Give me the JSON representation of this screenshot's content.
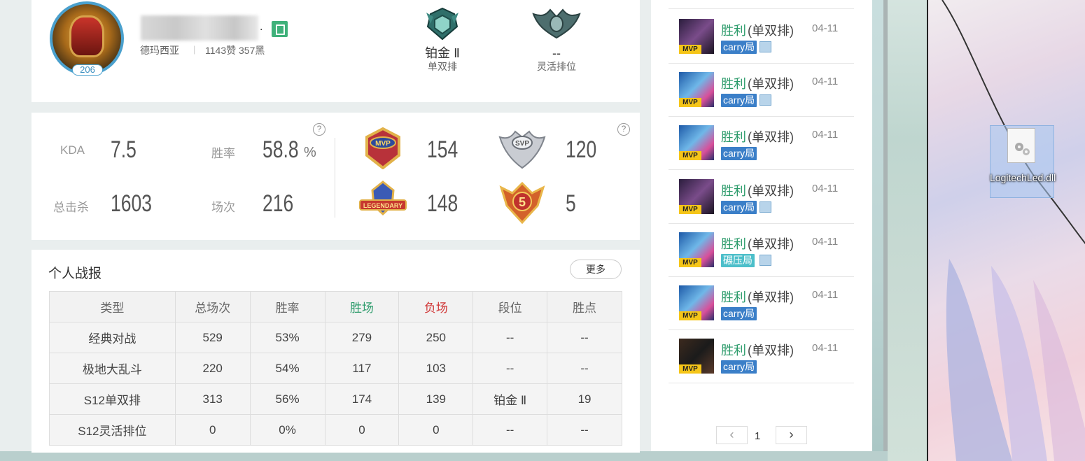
{
  "profile": {
    "name_suffix": ".",
    "level": "206",
    "server": "德玛西亚",
    "likes": "1143赞",
    "blacks": "357黑"
  },
  "ranks": [
    {
      "name": "铂金 Ⅱ",
      "mode": "单双排"
    },
    {
      "name": "--",
      "mode": "灵活排位"
    }
  ],
  "stats": {
    "kda_label": "KDA",
    "kda": "7.5",
    "winrate_label": "胜率",
    "winrate": "58.8",
    "winrate_unit": "%",
    "kills_label": "总击杀",
    "kills": "1603",
    "games_label": "场次",
    "games": "216",
    "help": "?"
  },
  "badges": [
    {
      "icon": "mvp-badge-icon",
      "value": "154"
    },
    {
      "icon": "svp-badge-icon",
      "value": "120"
    },
    {
      "icon": "legendary-badge-icon",
      "value": "148"
    },
    {
      "icon": "pentakill-badge-icon",
      "value": "5"
    }
  ],
  "report": {
    "title": "个人战报",
    "more": "更多",
    "headers": [
      "类型",
      "总场次",
      "胜率",
      "胜场",
      "负场",
      "段位",
      "胜点"
    ],
    "rows": [
      [
        "经典对战",
        "529",
        "53%",
        "279",
        "250",
        "--",
        "--"
      ],
      [
        "极地大乱斗",
        "220",
        "54%",
        "117",
        "103",
        "--",
        "--"
      ],
      [
        "S12单双排",
        "313",
        "56%",
        "174",
        "139",
        "铂金 Ⅱ",
        "19"
      ],
      [
        "S12灵活排位",
        "0",
        "0%",
        "0",
        "0",
        "--",
        "--"
      ]
    ]
  },
  "matches": [
    {
      "result": "胜利",
      "mode": "(单双排)",
      "date": "04-11",
      "tag": "carry局",
      "tag_type": "carry",
      "has_pic": true,
      "champ": "purple"
    },
    {
      "result": "胜利",
      "mode": "(单双排)",
      "date": "04-11",
      "tag": "carry局",
      "tag_type": "carry",
      "has_pic": true,
      "champ": "blue"
    },
    {
      "result": "胜利",
      "mode": "(单双排)",
      "date": "04-11",
      "tag": "carry局",
      "tag_type": "carry",
      "has_pic": false,
      "champ": "blue"
    },
    {
      "result": "胜利",
      "mode": "(单双排)",
      "date": "04-11",
      "tag": "carry局",
      "tag_type": "carry",
      "has_pic": true,
      "champ": "purple"
    },
    {
      "result": "胜利",
      "mode": "(单双排)",
      "date": "04-11",
      "tag": "碾压局",
      "tag_type": "crush",
      "has_pic": true,
      "champ": "blue"
    },
    {
      "result": "胜利",
      "mode": "(单双排)",
      "date": "04-11",
      "tag": "carry局",
      "tag_type": "carry",
      "has_pic": false,
      "champ": "blue"
    },
    {
      "result": "胜利",
      "mode": "(单双排)",
      "date": "04-11",
      "tag": "carry局",
      "tag_type": "carry",
      "has_pic": false,
      "champ": "dark"
    }
  ],
  "mvp_label": "MVP",
  "pager": {
    "prev": "‹",
    "page": "1",
    "next": "›"
  },
  "desktop_file": {
    "name": "LogitechLed.dll"
  }
}
